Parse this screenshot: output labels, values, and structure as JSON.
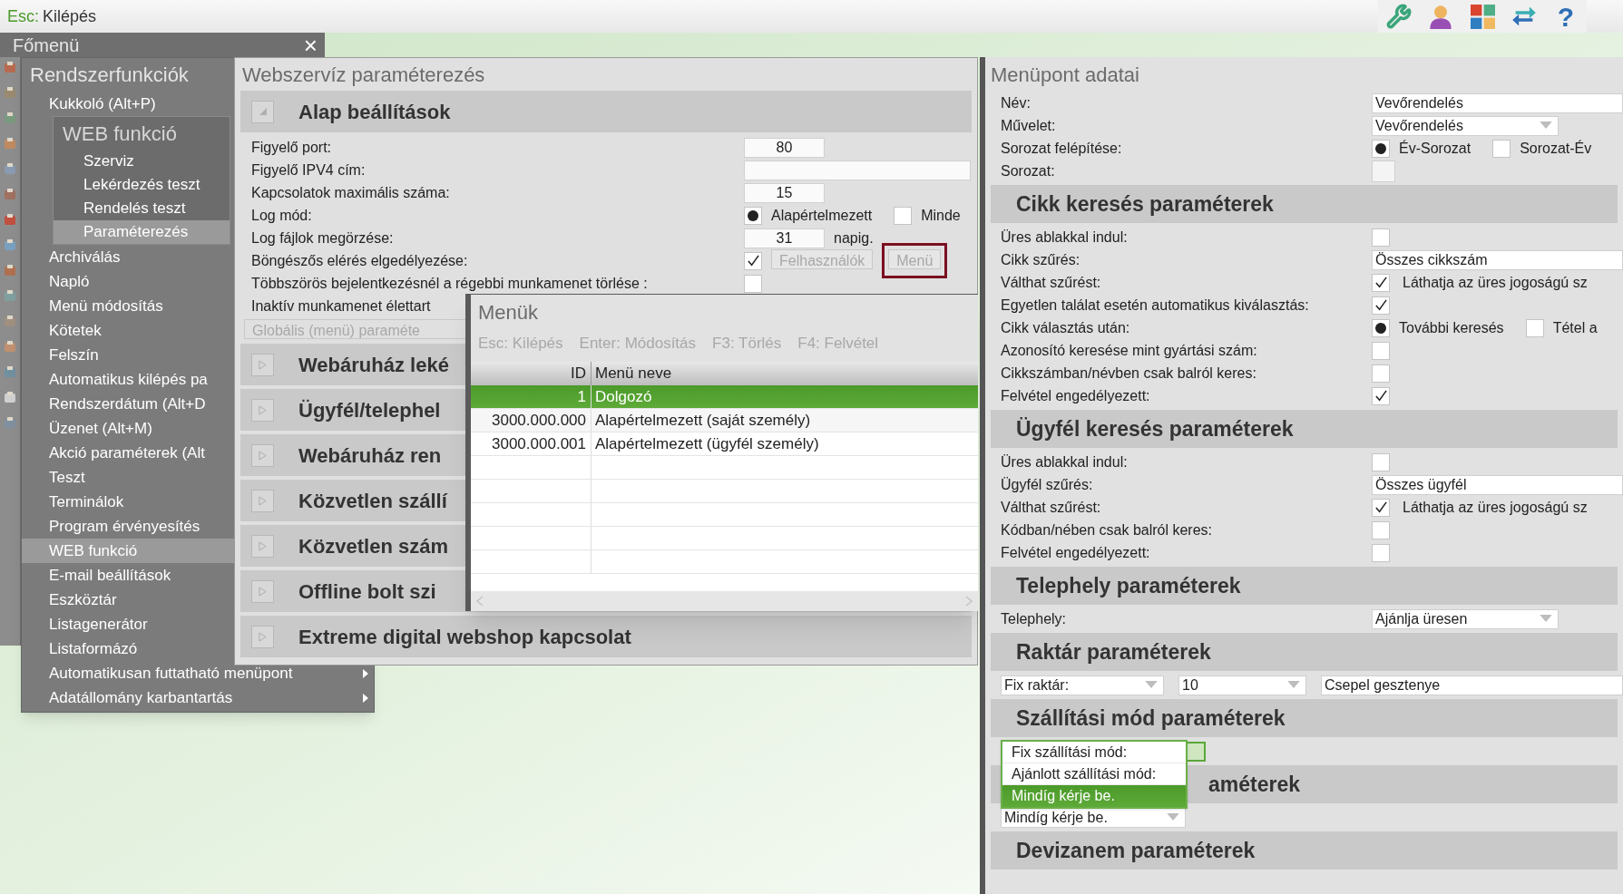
{
  "top_bar": {
    "shortcut": "Esc:",
    "action": "Kilépés",
    "help": "?"
  },
  "main_menu": {
    "title": "Főmenü",
    "close": "×"
  },
  "system_menu": {
    "title": "Rendszerfunkciók",
    "items": [
      {
        "kind": "item",
        "label": "Kukkoló (Alt+P)",
        "selected": false
      },
      {
        "kind": "submenu",
        "title": "WEB funkció",
        "items": [
          {
            "label": "Szerviz",
            "selected": false
          },
          {
            "label": "Lekérdezés teszt",
            "selected": false
          },
          {
            "label": "Rendelés teszt",
            "selected": false
          },
          {
            "label": "Paraméterezés",
            "selected": true
          }
        ]
      },
      {
        "kind": "item",
        "label": "Archiválás",
        "selected": false
      },
      {
        "kind": "item",
        "label": "Napló",
        "selected": false
      },
      {
        "kind": "item",
        "label": "Menü módosítás",
        "selected": false
      },
      {
        "kind": "item",
        "label": "Kötetek",
        "selected": false
      },
      {
        "kind": "item",
        "label": "Felszín",
        "selected": false
      },
      {
        "kind": "item",
        "label": "Automatikus kilépés pa",
        "selected": false
      },
      {
        "kind": "item",
        "label": "Rendszerdátum (Alt+D",
        "selected": false
      },
      {
        "kind": "item",
        "label": "Üzenet (Alt+M)",
        "selected": false
      },
      {
        "kind": "item",
        "label": "Akció paraméterek (Alt",
        "selected": false
      },
      {
        "kind": "item",
        "label": "Teszt",
        "selected": false
      },
      {
        "kind": "item",
        "label": "Terminálok",
        "selected": false
      },
      {
        "kind": "item",
        "label": "Program érvényesítés",
        "selected": false
      },
      {
        "kind": "item",
        "label": "WEB funkció",
        "selected": true
      },
      {
        "kind": "item",
        "label": "E-mail beállítások",
        "selected": false
      },
      {
        "kind": "item",
        "label": "Eszköztár",
        "selected": false
      },
      {
        "kind": "item",
        "label": "Listagenerátor",
        "selected": false
      },
      {
        "kind": "item",
        "label": "Listaformázó",
        "selected": false
      },
      {
        "kind": "item",
        "label": "Automatikusan futtatható menüpont",
        "selected": false,
        "has_submenu": true
      },
      {
        "kind": "item",
        "label": "Adatállomány karbantartás",
        "selected": false,
        "has_submenu": true
      }
    ]
  },
  "webservice": {
    "title": "Webszervíz paraméterezés",
    "sections": [
      {
        "title": "Alap beállítások",
        "expanded": true,
        "rows": [
          {
            "kind": "number",
            "label": "Figyelő port:",
            "value": "80"
          },
          {
            "kind": "text",
            "label": "Figyelő IPV4 cím:"
          },
          {
            "kind": "number",
            "label": "Kapcsolatok maximális száma:",
            "value": "15"
          },
          {
            "kind": "radio",
            "label": "Log mód:",
            "options": [
              {
                "label": "Alapértelmezett",
                "selected": true
              },
              {
                "label": "Minde",
                "selected": false
              }
            ]
          },
          {
            "kind": "number",
            "label": "Log fájlok megörzése:",
            "value": "31",
            "unit": "napig."
          },
          {
            "kind": "check",
            "label": "Böngészős elérés elgedélyezése:",
            "checked": true,
            "buttons": [
              {
                "label": "Felhasználók",
                "disabled": true,
                "focused": false
              },
              {
                "label": "Menü",
                "disabled": true,
                "focused": true
              }
            ]
          },
          {
            "kind": "check",
            "label": "Többszörös bejelentkezésnél a régebbi munkamenet törlése :",
            "checked": false
          },
          {
            "kind": "label",
            "label": "Inaktív munkamenet élettart"
          },
          {
            "kind": "button",
            "label": "Globális (menü) paraméte",
            "disabled": true
          }
        ]
      },
      {
        "title": "Webáruház leké",
        "expanded": false
      },
      {
        "title": "Ügyfél/telephel",
        "expanded": false
      },
      {
        "title": "Webáruház ren",
        "expanded": false
      },
      {
        "title": "Közvetlen szállí",
        "expanded": false
      },
      {
        "title": "Közvetlen szám",
        "expanded": false
      },
      {
        "title": "Offline bolt szi",
        "expanded": false
      },
      {
        "title": "Extreme digital webshop kapcsolat",
        "expanded": false
      }
    ]
  },
  "menus": {
    "title": "Menük",
    "shortcuts": [
      {
        "label": "Esc: Kilépés",
        "disabled": true
      },
      {
        "label": "Enter: Módosítás",
        "disabled": true
      },
      {
        "label": "F3: Törlés",
        "disabled": true
      },
      {
        "label": "F4: Felvétel",
        "disabled": true
      }
    ],
    "columns": [
      "ID",
      "Menü neve"
    ],
    "rows": [
      {
        "id": "1",
        "name": "Dolgozó",
        "selected": true
      },
      {
        "id": "3000.000.000",
        "name": "Alapértelmezett (saját személy)",
        "selected": false
      },
      {
        "id": "3000.000.001",
        "name": "Alapértelmezett (ügyfél személy)",
        "selected": false
      }
    ]
  },
  "item_details": {
    "title": "Menüpont adatai",
    "rows": [
      {
        "kind": "field",
        "label": "Név:",
        "value": "Vevőrendelés"
      },
      {
        "kind": "select",
        "label": "Művelet:",
        "value": "Vevőrendelés"
      },
      {
        "kind": "radio",
        "label": "Sorozat felépítése:",
        "options": [
          {
            "label": "Év-Sorozat",
            "selected": true
          },
          {
            "label": "Sorozat-Év",
            "selected": false
          }
        ]
      },
      {
        "kind": "small_field",
        "label": "Sorozat:"
      },
      {
        "kind": "header",
        "title": "Cikk keresés paraméterek"
      },
      {
        "kind": "check",
        "label": "Üres ablakkal indul:",
        "checked": false
      },
      {
        "kind": "field",
        "label": "Cikk szűrés:",
        "value": "Összes cikkszám"
      },
      {
        "kind": "check",
        "label": "Válthat szűrést:",
        "checked": true,
        "note": "Láthatja az üres jogoságú sz"
      },
      {
        "kind": "check",
        "label": "Egyetlen találat esetén automatikus kiválasztás:",
        "checked": true
      },
      {
        "kind": "radio",
        "label": "Cikk választás után:",
        "options": [
          {
            "label": "További keresés",
            "selected": true
          },
          {
            "label": "Tétel a",
            "selected": false
          }
        ]
      },
      {
        "kind": "check",
        "label": "Azonosító keresése mint gyártási szám:",
        "checked": false
      },
      {
        "kind": "check",
        "label": "Cikkszámban/névben csak balról keres:",
        "checked": false
      },
      {
        "kind": "check",
        "label": "Felvétel engedélyezett:",
        "checked": true
      },
      {
        "kind": "header",
        "title": "Ügyfél keresés paraméterek"
      },
      {
        "kind": "check",
        "label": "Üres ablakkal indul:",
        "checked": false
      },
      {
        "kind": "field",
        "label": "Ügyfél szűrés:",
        "value": "Összes ügyfél"
      },
      {
        "kind": "check",
        "label": "Válthat szűrést:",
        "checked": true,
        "note": "Láthatja az üres jogoságú sz"
      },
      {
        "kind": "check",
        "label": "Kódban/nében csak balról keres:",
        "checked": false
      },
      {
        "kind": "check",
        "label": "Felvétel engedélyezett:",
        "checked": false
      },
      {
        "kind": "header",
        "title": "Telephely paraméterek"
      },
      {
        "kind": "select",
        "label": "Telephely:",
        "value": "Ajánlja üresen"
      },
      {
        "kind": "header",
        "title": "Raktár paraméterek"
      },
      {
        "kind": "combo",
        "controls": [
          {
            "kind": "select",
            "value": "Fix raktár:"
          },
          {
            "kind": "select",
            "value": "10"
          },
          {
            "kind": "field",
            "value": "Csepel gesztenye"
          }
        ]
      },
      {
        "kind": "header",
        "title": "Szállítási mód paraméterek"
      },
      {
        "kind": "open_select",
        "options": [
          {
            "label": "Fix szállítási mód:",
            "selected": false
          },
          {
            "label": "Ajánlott szállítási mód:",
            "selected": false
          },
          {
            "label": "Mindíg kérje be.",
            "selected": true
          }
        ]
      },
      {
        "kind": "covered_header",
        "title": "améterek"
      },
      {
        "kind": "combo",
        "controls": [
          {
            "kind": "select",
            "value": "Mindíg kérje be."
          }
        ]
      },
      {
        "kind": "header",
        "title": "Devizanem paraméterek"
      }
    ]
  }
}
